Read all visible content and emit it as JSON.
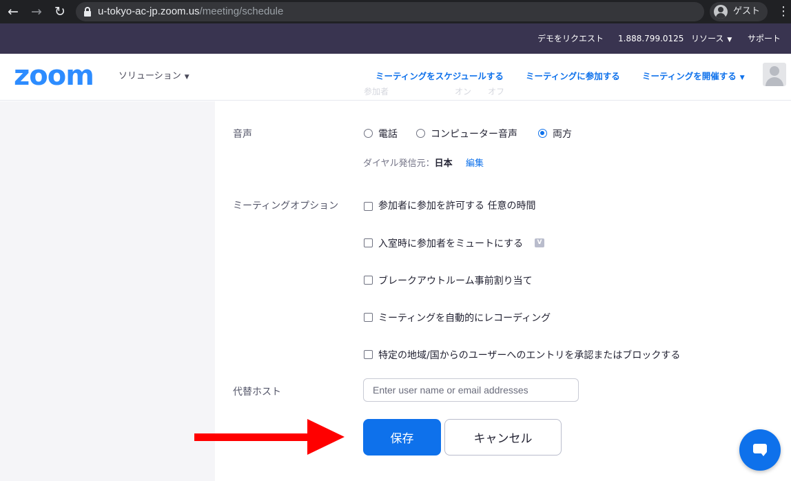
{
  "browser": {
    "back_icon": "arrow-left-icon",
    "forward_icon": "arrow-right-icon",
    "reload_icon": "reload-icon",
    "url_host": "u-tokyo-ac-jp.zoom.us",
    "url_path": "/meeting/schedule",
    "profile_label": "ゲスト",
    "menu_icon": "kebab-icon"
  },
  "top_bar": {
    "demo_request": "デモをリクエスト",
    "phone": "1.888.799.0125",
    "resources": "リソース",
    "support": "サポート"
  },
  "nav": {
    "logo": "zoom",
    "solutions": "ソリューション",
    "schedule": "ミーティングをスケジュールする",
    "join": "ミーティングに参加する",
    "host": "ミーティングを開催する",
    "ghost_row": "参加者　　　　　　　　オン　　オフ"
  },
  "form": {
    "audio": {
      "label": "音声",
      "options": [
        "電話",
        "コンピューター音声",
        "両方"
      ],
      "selected": "両方",
      "dial_from_label": "ダイヤル発信元：",
      "dial_from_value": "日本",
      "edit": "編集"
    },
    "meeting_options": {
      "label": "ミーティングオプション",
      "items": [
        "参加者に参加を許可する 任意の時間",
        "入室時に参加者をミュートにする",
        "ブレークアウトルーム事前割り当て",
        "ミーティングを自動的にレコーディング",
        "特定の地域/国からのユーザーへのエントリを承認またはブロックする"
      ],
      "badge": "V"
    },
    "alt_host": {
      "label": "代替ホスト",
      "placeholder": "Enter user name or email addresses",
      "value": ""
    },
    "save": "保存",
    "cancel": "キャンセル"
  },
  "colors": {
    "accent": "#0e71eb",
    "top_bar": "#393450",
    "arrow": "#ff0000"
  }
}
